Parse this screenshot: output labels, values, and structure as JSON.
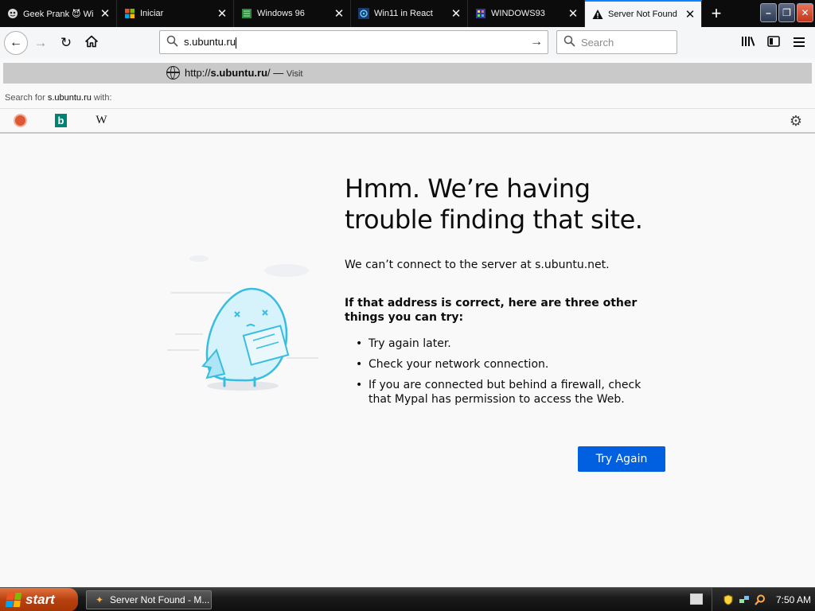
{
  "tabs": [
    {
      "title": "Geek Prank 😈 Wi",
      "favicon": "mask-icon",
      "active": false
    },
    {
      "title": "Iniciar",
      "favicon": "windows-logo-icon",
      "active": false
    },
    {
      "title": "Windows 96",
      "favicon": "windows96-icon",
      "active": false
    },
    {
      "title": "Win11 in React",
      "favicon": "react-icon",
      "active": false
    },
    {
      "title": "WINDOWS93",
      "favicon": "windows93-icon",
      "active": false
    },
    {
      "title": "Server Not Found",
      "favicon": "warning-icon",
      "active": true
    }
  ],
  "navbar": {
    "url_value": "s.ubuntu.ru",
    "search_placeholder": "Search"
  },
  "suggestion": {
    "prefix": "http://",
    "host": "s.ubuntu.ru",
    "suffix": "/",
    "dash": "—",
    "action": "Visit"
  },
  "searchfor": {
    "prefix": "Search for ",
    "term": "s.ubuntu.ru",
    "suffix": " with:"
  },
  "engines": {
    "wiki_label": "W"
  },
  "error": {
    "title": "Hmm. We’re having trouble finding that site.",
    "description": "We can’t connect to the server at s.ubuntu.net.",
    "subtitle": "If that address is correct, here are three other things you can try:",
    "tips": [
      "Try again later.",
      "Check your network connection.",
      "If you are connected but behind a firewall, check that Mypal has permission to access the Web."
    ],
    "button_label": "Try Again"
  },
  "taskbar": {
    "start_label": "start",
    "task_label": "Server Not Found - M...",
    "clock": "7:50 AM"
  },
  "colors": {
    "accent": "#0060df",
    "tab_strip": "#0c0c0d",
    "start_orange": "#b8400f"
  }
}
